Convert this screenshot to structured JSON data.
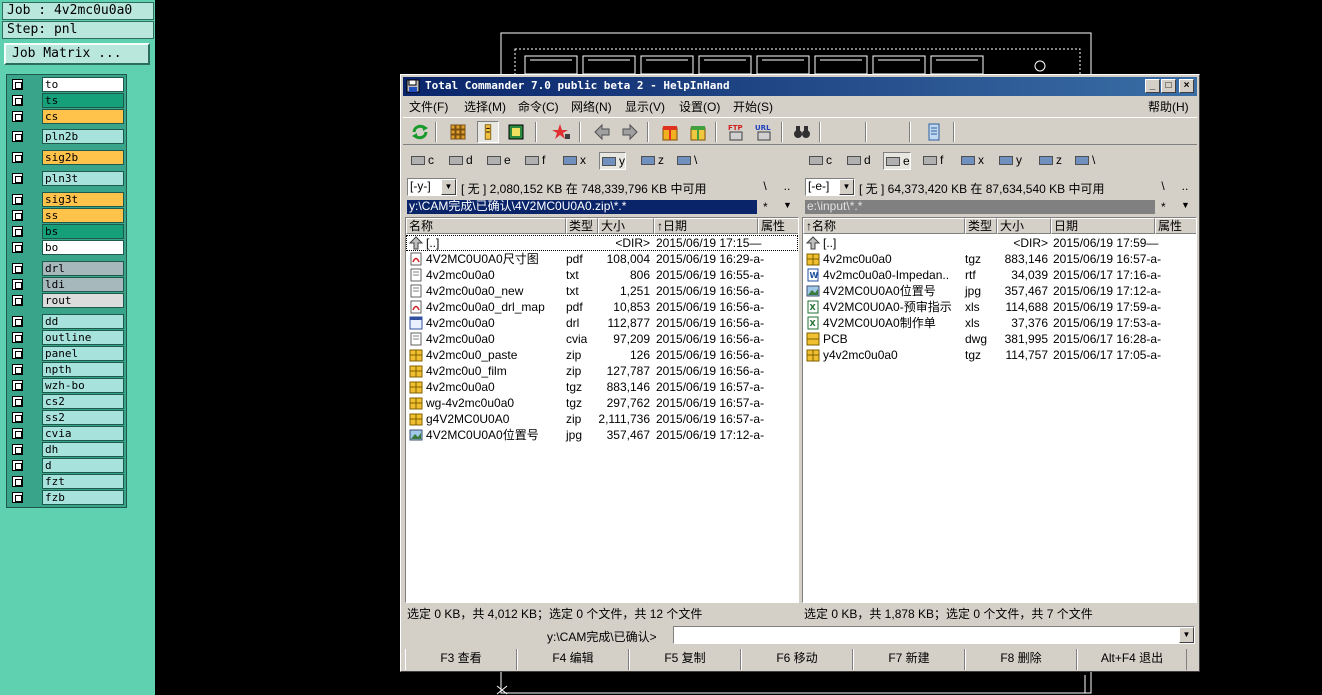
{
  "cam": {
    "job": "Job : 4v2mc0u0a0",
    "step": "Step: pnl",
    "job_matrix": "Job Matrix ...",
    "layers": [
      {
        "name": "to",
        "color": "#ffffff"
      },
      {
        "name": "ts",
        "color": "#16a07a"
      },
      {
        "name": "cs",
        "color": "#ffc24a"
      },
      {
        "name": "pln2b",
        "color": "#a8e2dc"
      },
      {
        "name": "sig2b",
        "color": "#ffc24a"
      },
      {
        "name": "pln3t",
        "color": "#a8e2dc"
      },
      {
        "name": "sig3t",
        "color": "#ffc24a"
      },
      {
        "name": "ss",
        "color": "#ffc24a"
      },
      {
        "name": "bs",
        "color": "#16a07a"
      },
      {
        "name": "bo",
        "color": "#ffffff"
      },
      {
        "name": "drl",
        "color": "#a7b8bc"
      },
      {
        "name": "ldi",
        "color": "#a7b8bc"
      },
      {
        "name": "rout",
        "color": "#dcdcdc"
      },
      {
        "name": "dd",
        "color": "#a8e2dc"
      },
      {
        "name": "outline",
        "color": "#a8e2dc"
      },
      {
        "name": "panel",
        "color": "#a8e2dc"
      },
      {
        "name": "npth",
        "color": "#a8e2dc"
      },
      {
        "name": "wzh-bo",
        "color": "#a8e2dc"
      },
      {
        "name": "cs2",
        "color": "#a8e2dc"
      },
      {
        "name": "ss2",
        "color": "#a8e2dc"
      },
      {
        "name": "cvia",
        "color": "#a8e2dc"
      },
      {
        "name": "dh",
        "color": "#a8e2dc"
      },
      {
        "name": "d",
        "color": "#a8e2dc"
      },
      {
        "name": "fzt",
        "color": "#a8e2dc"
      },
      {
        "name": "fzb",
        "color": "#a8e2dc"
      }
    ]
  },
  "tc": {
    "title": "Total Commander 7.0 public beta 2 - HelpInHand",
    "window_buttons": {
      "minimize": "_",
      "maximize": "□",
      "close": "×"
    },
    "menu": [
      "文件(F)",
      "选择(M)",
      "命令(C)",
      "网络(N)",
      "显示(V)",
      "设置(O)",
      "开始(S)"
    ],
    "help": "帮助(H)",
    "left": {
      "drives": [
        "c",
        "d",
        "e",
        "f",
        "x",
        "y",
        "z",
        "\\"
      ],
      "active_drive": "y",
      "combo": "[-y-]",
      "free": "[ 无 ]  2,080,152 KB 在 748,339,796 KB 中可用",
      "root_btn": "\\",
      "up_btn": "..",
      "path": "y:\\CAM完成\\已确认\\4V2MC0U0A0.zip\\*.*",
      "star": "*",
      "headers": {
        "name": "名称",
        "ext": "类型",
        "size": "大小",
        "date": "↑日期",
        "attr": "属性"
      },
      "files": [
        {
          "name": "[..]",
          "ext": "",
          "size": "<DIR>",
          "date": "2015/06/19 17:15—",
          "icon": "up"
        },
        {
          "name": "4V2MC0U0A0尺寸图",
          "ext": "pdf",
          "size": "108,004",
          "date": "2015/06/19 16:29-a-",
          "icon": "pdf"
        },
        {
          "name": "4v2mc0u0a0",
          "ext": "txt",
          "size": "806",
          "date": "2015/06/19 16:55-a-",
          "icon": "doc"
        },
        {
          "name": "4v2mc0u0a0_new",
          "ext": "txt",
          "size": "1,251",
          "date": "2015/06/19 16:56-a-",
          "icon": "doc"
        },
        {
          "name": "4v2mc0u0a0_drl_map",
          "ext": "pdf",
          "size": "10,853",
          "date": "2015/06/19 16:56-a-",
          "icon": "pdf"
        },
        {
          "name": "4v2mc0u0a0",
          "ext": "drl",
          "size": "112,877",
          "date": "2015/06/19 16:56-a-",
          "icon": "drl"
        },
        {
          "name": "4v2mc0u0a0",
          "ext": "cvia",
          "size": "97,209",
          "date": "2015/06/19 16:56-a-",
          "icon": "doc"
        },
        {
          "name": "4v2mc0u0_paste",
          "ext": "zip",
          "size": "126",
          "date": "2015/06/19 16:56-a-",
          "icon": "zip"
        },
        {
          "name": "4v2mc0u0_film",
          "ext": "zip",
          "size": "127,787",
          "date": "2015/06/19 16:56-a-",
          "icon": "zip"
        },
        {
          "name": "4v2mc0u0a0",
          "ext": "tgz",
          "size": "883,146",
          "date": "2015/06/19 16:57-a-",
          "icon": "zip"
        },
        {
          "name": "wg-4v2mc0u0a0",
          "ext": "tgz",
          "size": "297,762",
          "date": "2015/06/19 16:57-a-",
          "icon": "zip"
        },
        {
          "name": "g4V2MC0U0A0",
          "ext": "zip",
          "size": "2,111,736",
          "date": "2015/06/19 16:57-a-",
          "icon": "zip"
        },
        {
          "name": "4V2MC0U0A0位置号",
          "ext": "jpg",
          "size": "357,467",
          "date": "2015/06/19 17:12-a-",
          "icon": "img"
        }
      ],
      "status": "选定 0 KB，共 4,012 KB；选定 0 个文件，共 12 个文件"
    },
    "right": {
      "drives": [
        "c",
        "d",
        "e",
        "f",
        "x",
        "y",
        "z",
        "\\"
      ],
      "active_drive": "e",
      "combo": "[-e-]",
      "free": "[ 无 ]  64,373,420 KB 在 87,634,540 KB 中可用",
      "root_btn": "\\",
      "up_btn": "..",
      "path": "e:\\input\\*.*",
      "star": "*",
      "headers": {
        "name": "↑名称",
        "ext": "类型",
        "size": "大小",
        "date": "日期",
        "attr": "属性"
      },
      "files": [
        {
          "name": "[..]",
          "ext": "",
          "size": "<DIR>",
          "date": "2015/06/19 17:59—",
          "icon": "up"
        },
        {
          "name": "4v2mc0u0a0",
          "ext": "tgz",
          "size": "883,146",
          "date": "2015/06/19 16:57-a-",
          "icon": "zip"
        },
        {
          "name": "4v2mc0u0a0-Impedan..",
          "ext": "rtf",
          "size": "34,039",
          "date": "2015/06/17 17:16-a-",
          "icon": "rtf"
        },
        {
          "name": "4V2MC0U0A0位置号",
          "ext": "jpg",
          "size": "357,467",
          "date": "2015/06/19 17:12-a-",
          "icon": "img"
        },
        {
          "name": "4V2MC0U0A0-预审指示",
          "ext": "xls",
          "size": "114,688",
          "date": "2015/06/19 17:59-a-",
          "icon": "xls"
        },
        {
          "name": "4V2MC0U0A0制作单",
          "ext": "xls",
          "size": "37,376",
          "date": "2015/06/19 17:53-a-",
          "icon": "xls"
        },
        {
          "name": "PCB",
          "ext": "dwg",
          "size": "381,995",
          "date": "2015/06/17 16:28-a-",
          "icon": "dwg"
        },
        {
          "name": "y4v2mc0u0a0",
          "ext": "tgz",
          "size": "114,757",
          "date": "2015/06/17 17:05-a-",
          "icon": "zip"
        }
      ],
      "status": "选定 0 KB，共 1,878 KB；选定 0 个文件，共 7 个文件"
    },
    "cmd_label": "y:\\CAM完成\\已确认>",
    "fkeys": [
      "F3 查看",
      "F4 编辑",
      "F5 复制",
      "F6 移动",
      "F7 新建",
      "F8 删除",
      "Alt+F4 退出"
    ],
    "colors": {
      "title_start": "#0a246a",
      "title_end": "#3a6ea5",
      "active_path": "#0a246a",
      "inactive_path": "#808080"
    }
  }
}
